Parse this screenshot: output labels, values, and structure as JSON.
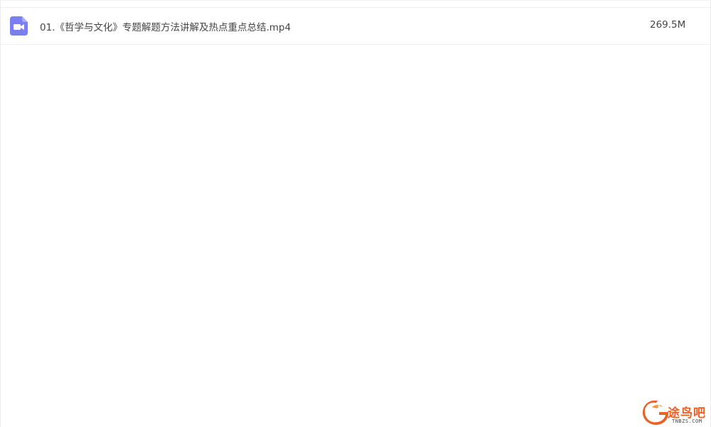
{
  "files": [
    {
      "icon": "video-file-icon",
      "name": "01.《哲学与文化》专题解题方法讲解及热点重点总结.mp4",
      "size": "269.5M"
    }
  ],
  "watermark": {
    "brand": "途鸟吧",
    "domain": "TNBZS.COM",
    "color": "#e8632a"
  },
  "colors": {
    "icon": "#7b7ef0",
    "text": "#454545"
  }
}
